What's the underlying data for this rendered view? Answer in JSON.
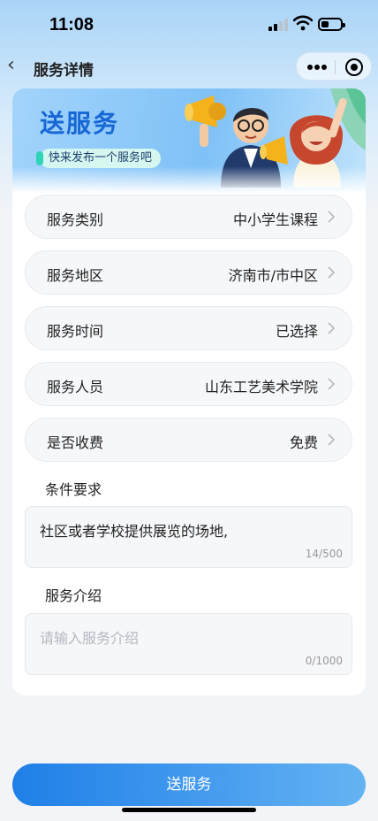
{
  "status_bar": {
    "time": "11:08"
  },
  "nav": {
    "title": "服务详情"
  },
  "banner": {
    "title": "送服务",
    "subtitle": "快来发布一个服务吧"
  },
  "form": {
    "rows": [
      {
        "label": "服务类别",
        "value": "中小学生课程"
      },
      {
        "label": "服务地区",
        "value": "济南市/市中区"
      },
      {
        "label": "服务时间",
        "value": "已选择"
      },
      {
        "label": "服务人员",
        "value": "山东工艺美术学院"
      },
      {
        "label": "是否收费",
        "value": "免费"
      }
    ],
    "conditions": {
      "label": "条件要求",
      "value": "社区或者学校提供展览的场地,",
      "counter": "14/500"
    },
    "intro": {
      "label": "服务介绍",
      "placeholder": "请输入服务介绍",
      "counter": "0/1000"
    }
  },
  "submit_label": "送服务",
  "icons": {
    "back": "chevron-left-icon",
    "more": "more-dots-icon",
    "target": "target-icon",
    "row_arrow": "chevron-right-icon"
  },
  "colors": {
    "accent": "#1f7fe8",
    "banner_title": "#1768d6"
  }
}
